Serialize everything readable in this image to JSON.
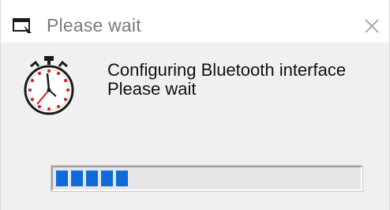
{
  "window": {
    "title": "Please wait"
  },
  "message": {
    "line1": "Configuring Bluetooth interface",
    "line2": "Please wait"
  },
  "progress": {
    "segments_filled": 5,
    "fraction": 0.24
  },
  "icons": {
    "title": "window-app-icon",
    "close": "close-icon",
    "main": "stopwatch-icon"
  },
  "colors": {
    "progress_fill": "#0f6bd8",
    "title_text": "#7a7a7a"
  }
}
